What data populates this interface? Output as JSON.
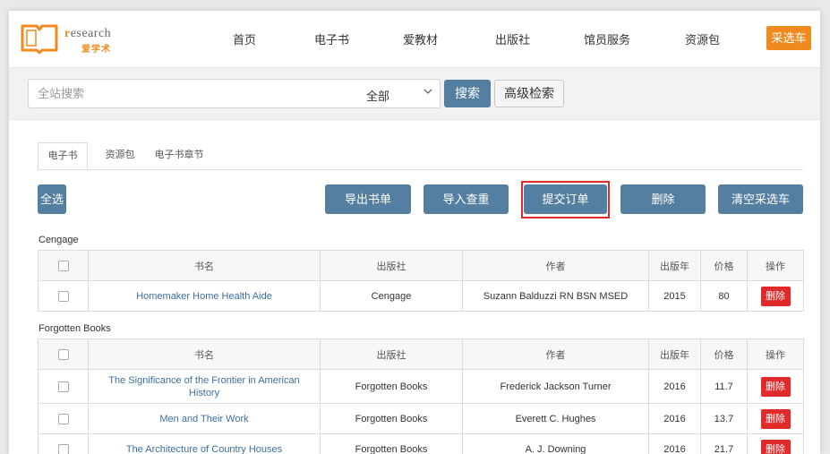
{
  "header": {
    "logo_text_r": "r",
    "logo_text_rest": "esearch",
    "logo_sub": "爱学术",
    "nav": [
      {
        "label": "首页"
      },
      {
        "label": "电子书"
      },
      {
        "label": "爱教材"
      },
      {
        "label": "出版社"
      },
      {
        "label": "馆员服务"
      },
      {
        "label": "资源包"
      }
    ],
    "cart_label": "采选车"
  },
  "search": {
    "placeholder": "全站搜索",
    "scope": "全部",
    "search_label": "搜索",
    "advanced_label": "高级检索"
  },
  "tabs": [
    {
      "label": "电子书",
      "active": true
    },
    {
      "label": "资源包",
      "active": false
    },
    {
      "label": "电子书章节",
      "active": false
    }
  ],
  "actions": {
    "select_all": "全选",
    "export": "导出书单",
    "import_check": "导入查重",
    "submit_order": "提交订单",
    "delete": "删除",
    "clear_cart": "清空采选车"
  },
  "table_headers": [
    "书名",
    "出版社",
    "作者",
    "出版年",
    "价格",
    "操作"
  ],
  "row_action": "删除",
  "groups": [
    {
      "name": "Cengage",
      "rows": [
        {
          "title": "Homemaker Home Health Aide",
          "publisher": "Cengage",
          "author": "Suzann Balduzzi RN BSN MSED",
          "year": "2015",
          "price": "80"
        }
      ]
    },
    {
      "name": "Forgotten Books",
      "rows": [
        {
          "title": "The Significance of the Frontier in American History",
          "publisher": "Forgotten Books",
          "author": "Frederick Jackson Turner",
          "year": "2016",
          "price": "11.7"
        },
        {
          "title": "Men and Their Work",
          "publisher": "Forgotten Books",
          "author": "Everett C. Hughes",
          "year": "2016",
          "price": "13.7"
        },
        {
          "title": "The Architecture of Country Houses",
          "publisher": "Forgotten Books",
          "author": "A. J. Downing",
          "year": "2016",
          "price": "21.7"
        }
      ]
    }
  ],
  "colors": {
    "brand_orange": "#f08a1e",
    "button_blue": "#557fa1",
    "danger_red": "#e02a2a",
    "link_blue": "#3b6fa0"
  }
}
